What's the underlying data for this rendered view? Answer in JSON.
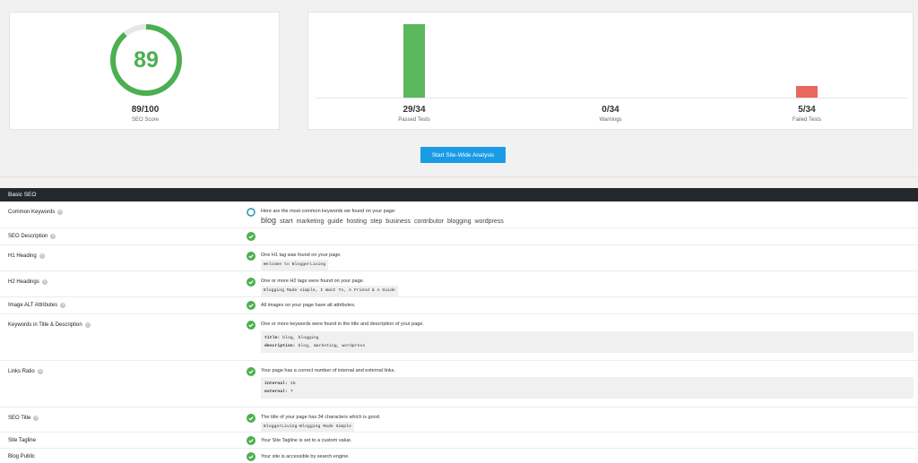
{
  "score": {
    "number": "89",
    "value": "89/100",
    "caption": "SEO Score",
    "fraction": 0.89,
    "color": "#4caf50"
  },
  "tests": {
    "passed": {
      "value": "29/34",
      "caption": "Passed Tests",
      "color": "#5cb85c"
    },
    "warnings": {
      "value": "0/34",
      "caption": "Warnings"
    },
    "failed": {
      "value": "5/34",
      "caption": "Failed Tests",
      "color": "#e8685f"
    }
  },
  "start_button": "Start Site-Wide Analysis",
  "section_title": "Basic SEO",
  "rows": {
    "keywords": {
      "label": "Common Keywords",
      "text": "Here are the most common keywords we found on your page:",
      "keywords": [
        "blog",
        "start",
        "marketing",
        "guide",
        "hosting",
        "step",
        "business",
        "contributor",
        "blogging",
        "wordpress"
      ]
    },
    "description": {
      "label": "SEO Description"
    },
    "h1": {
      "label": "H1 Heading",
      "text": "One H1 tag was found on your page.",
      "code": "Welcome to BloggerLiving"
    },
    "h2": {
      "label": "H2 Headings",
      "text": "One or more H2 tags were found on your page.",
      "code": "Blogging Made simple, I Want To, A Friend & A Guide"
    },
    "alt": {
      "label": "Image ALT Attributes",
      "text": "All images on your page have alt attributes."
    },
    "kw_title": {
      "label": "Keywords in Title & Description",
      "text": "One or more keywords were found in the title and description of your page.",
      "line1_key": "title:",
      "line1_val": "blog, blogging",
      "line2_key": "description:",
      "line2_val": "blog, marketing, wordpress"
    },
    "links": {
      "label": "Links Ratio",
      "text": "Your page has a correct number of internal and external links.",
      "line1_key": "internal:",
      "line1_val": "15",
      "line2_key": "external:",
      "line2_val": "7"
    },
    "seo_title": {
      "label": "SEO Title",
      "text": "The title of your page has 34 characters which is good.",
      "code": "BloggerLiving-Blogging Made Simple"
    },
    "tagline": {
      "label": "Site Tagline",
      "text": "Your Site Tagline is set to a custom value."
    },
    "public": {
      "label": "Blog Public",
      "text": "Your site is accessible by search engine."
    }
  },
  "help_glyph": "?",
  "icons": {
    "pass": "check-circle-icon",
    "neutral": "ring-icon",
    "help": "help-icon"
  },
  "colors": {
    "pass": "#4caf50",
    "neutral": "#1a8fa8",
    "header": "#23282d",
    "button": "#1a9be6"
  }
}
